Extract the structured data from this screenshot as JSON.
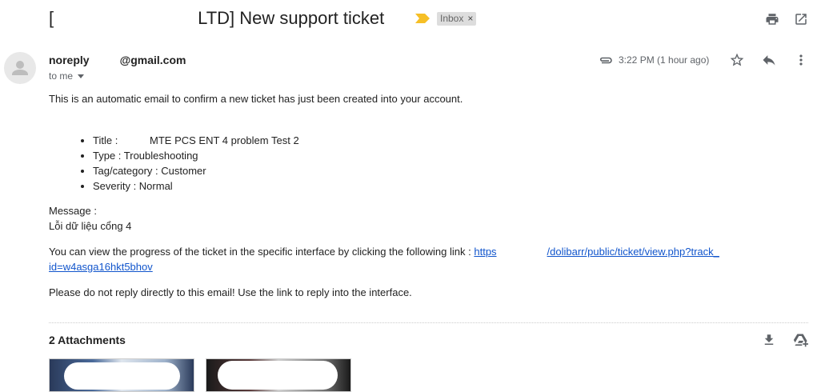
{
  "email": {
    "subject_prefix": "[",
    "subject_suffix": "LTD] New support ticket",
    "label": "Inbox",
    "label_close": "×",
    "sender_local": "noreply",
    "sender_domain": "@gmail.com",
    "recipient": "to me",
    "time": "3:22 PM (1 hour ago)",
    "intro": "This is an automatic email to confirm a new ticket has just been created into your account.",
    "fields": [
      "Title :           MTE PCS ENT 4 problem Test 2",
      "Type : Troubleshooting",
      "Tag/category : Customer",
      "Severity : Normal"
    ],
    "message_label": "Message :",
    "message_text": "Lỗi dữ liệu cổng 4",
    "progress_text": "You can view the progress of the ticket in the specific interface by clicking the following link : ",
    "link_part1": "https",
    "link_part2": "/dolibarr/public/ticket/view.php?track_",
    "link_part3": "id=w4asga16hkt5bhov",
    "footer_note": "Please do not reply directly to this email! Use the link to reply into the interface.",
    "attachments_title": "2 Attachments"
  },
  "icons": {
    "print": "print-icon",
    "open_new_window": "open-in-new-window-icon",
    "importance": "importance-marker-icon",
    "attachment": "paperclip-icon",
    "star": "star-icon",
    "reply": "reply-icon",
    "more": "more-vertical-icon",
    "download": "download-icon",
    "drive": "add-to-drive-icon"
  },
  "colors": {
    "link": "#1155cc",
    "importance": "#f6bf26",
    "badge_bg": "#dddddd"
  }
}
